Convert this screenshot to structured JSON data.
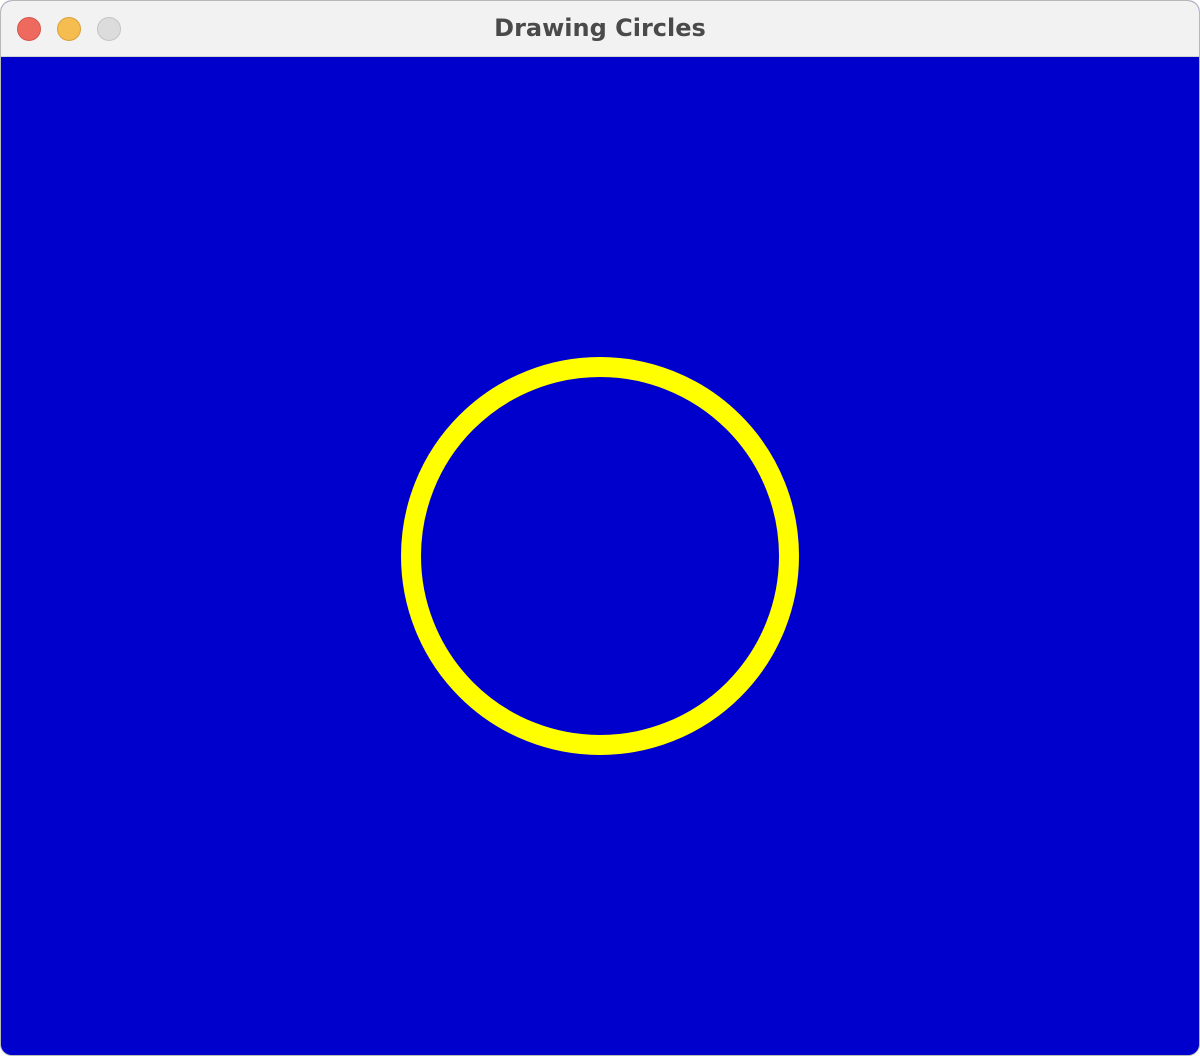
{
  "window": {
    "title": "Drawing Circles"
  },
  "controls": {
    "close": "close-icon",
    "minimize": "minimize-icon",
    "zoom": "zoom-icon"
  },
  "canvas": {
    "background_color": "#0000cc",
    "circle_stroke_color": "#ffff00",
    "circle_fill": "none"
  }
}
